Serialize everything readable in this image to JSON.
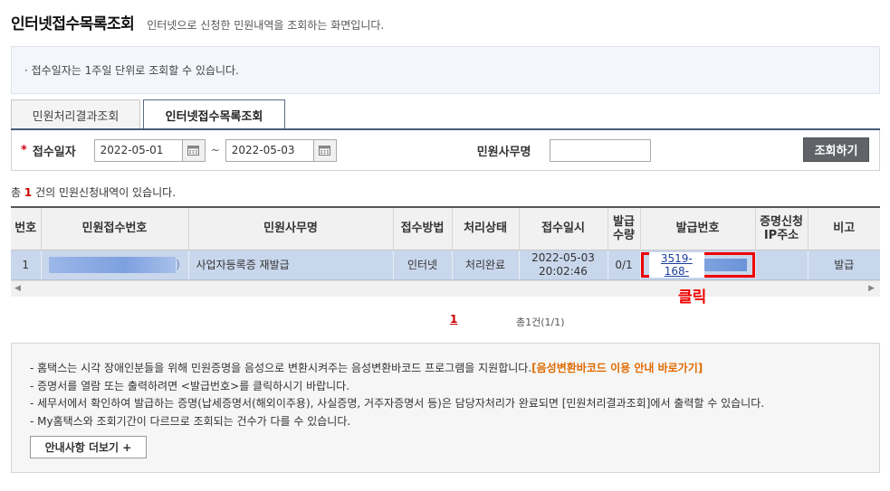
{
  "header": {
    "title": "인터넷접수목록조회",
    "description": "인터넷으로 신청한 민원내역을 조회하는 화면입니다."
  },
  "notice": "· 접수일자는 1주일 단위로 조회할 수 있습니다.",
  "tabs": [
    {
      "label": "민원처리결과조회",
      "active": false
    },
    {
      "label": "인터넷접수목록조회",
      "active": true
    }
  ],
  "search": {
    "required_mark": "*",
    "date_label": "접수일자",
    "date_from": "2022-05-01",
    "tilde": "~",
    "date_to": "2022-05-03",
    "office_label": "민원사무명",
    "office_value": "",
    "search_button": "조회하기"
  },
  "count": {
    "prefix": "총",
    "number": "1",
    "suffix": "건의 민원신청내역이 있습니다."
  },
  "table": {
    "headers": [
      "번호",
      "민원접수번호",
      "민원사무명",
      "접수방법",
      "처리상태",
      "접수일시",
      "발급\n수량",
      "발급번호",
      "증명신청\nIP주소",
      "비고"
    ],
    "rows": [
      {
        "no": "1",
        "receipt_no_suffix": ")",
        "office": "사업자등록증 재발급",
        "method": "인터넷",
        "status": "처리완료",
        "date": "2022-05-03",
        "time": "20:02:46",
        "qty": "0/1",
        "issue_no": "3519-168-",
        "ip": "",
        "remark": "발급"
      }
    ]
  },
  "click_note": "클릭",
  "pager": {
    "current": "1",
    "info": "총1건(1/1)"
  },
  "guide": {
    "items": [
      "- 홈택스는 시각 장애인분들을 위해 민원증명을 음성으로 변환시켜주는 음성변환바코드 프로그램을 지원합니다.",
      "- 증명서를 열람 또는 출력하려면 <발급번호>를 클릭하시기 바랍니다.",
      "- 세무서에서 확인하여 발급하는 증명(납세증명서(해외이주용), 사실증명, 거주자증명서 등)은 담당자처리가 완료되면 [민원처리결과조회]에서 출력할 수 있습니다.",
      "- My홈택스와 조회기간이 다르므로 조회되는 건수가 다를 수 있습니다."
    ],
    "link": "[음성변환바코드 이용 안내 바로가기]",
    "more_button": "안내사항 더보기 +"
  }
}
